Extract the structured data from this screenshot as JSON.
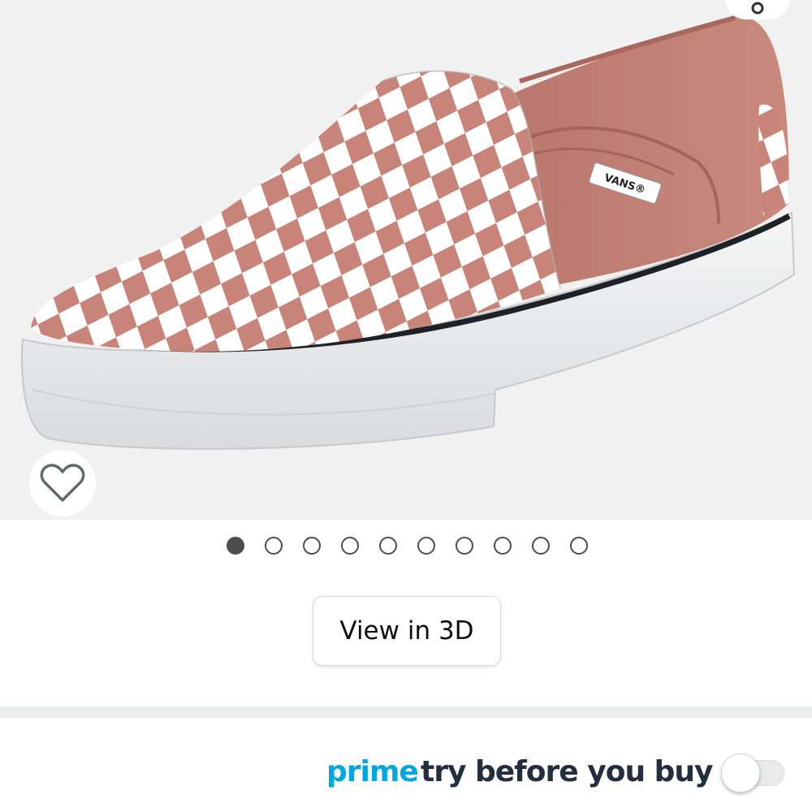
{
  "gallery": {
    "image_alt": "Vans checkerboard slip-on shoe",
    "brand_tag": "VANS®",
    "current_image": 1,
    "total_images": 10
  },
  "view_3d": {
    "label": "View in 3D"
  },
  "prime_try": {
    "prime_label": "prime",
    "text": "try before you buy",
    "toggle_on": false
  },
  "colors": {
    "prime_blue": "#00a8e1",
    "prime_text": "#232f3e",
    "dot_active": "#4d4d4d",
    "shoe_pink": "#c88478",
    "background": "#f1f1f1"
  },
  "icons": {
    "wishlist": "heart-outline-icon",
    "share": "share-icon"
  }
}
